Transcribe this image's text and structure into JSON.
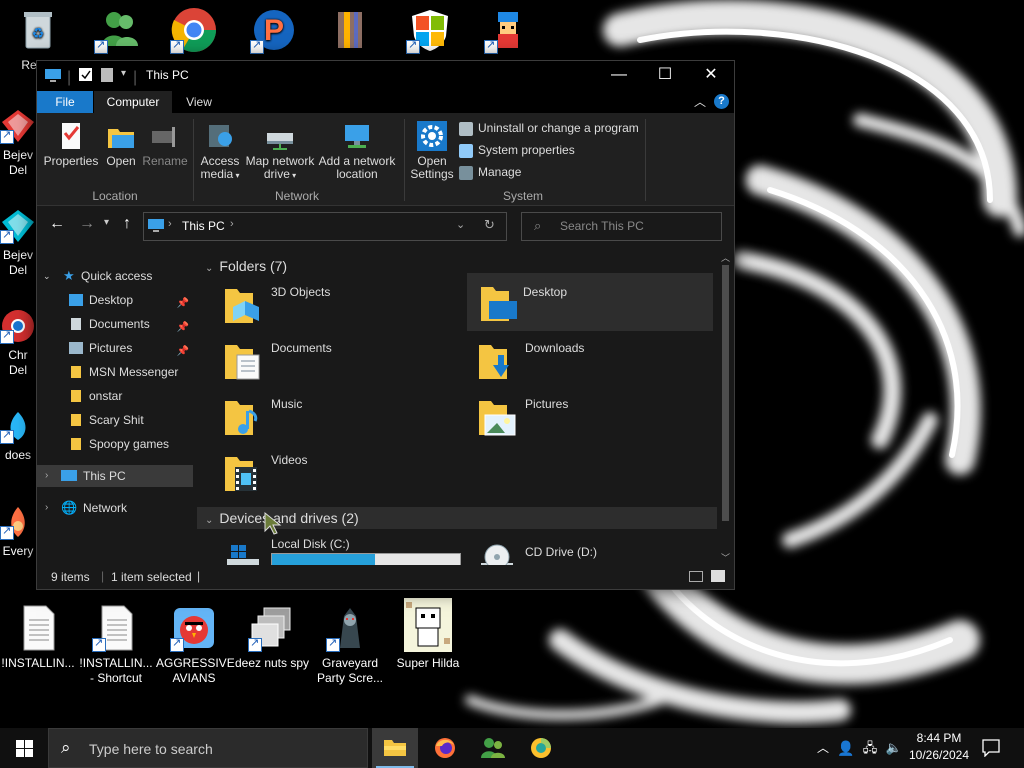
{
  "desktop": {
    "left_icons": [
      "Recyc",
      "Bejev Del",
      "Bejev Del",
      "Chr Del",
      "does",
      "Every"
    ],
    "top_icons": [
      "",
      "",
      "",
      "",
      "",
      "",
      ""
    ],
    "bottom_icons": [
      {
        "label": "!INSTALLIN..."
      },
      {
        "label": "!INSTALLIN... - Shortcut"
      },
      {
        "label": "AGGRESSIVE AVIANS"
      },
      {
        "label": "deez nuts spy"
      },
      {
        "label": "Graveyard Party Scre..."
      },
      {
        "label": "Super Hilda"
      }
    ]
  },
  "window": {
    "title": "This PC",
    "controls": {
      "minimize": "—",
      "maximize": "☐",
      "close": "✕"
    },
    "tabs": [
      {
        "label": "File"
      },
      {
        "label": "Computer"
      },
      {
        "label": "View"
      }
    ],
    "ribbon": {
      "location": {
        "group": "Location",
        "items": [
          "Properties",
          "Open",
          "Rename"
        ]
      },
      "network": {
        "group": "Network",
        "items": [
          "Access media",
          "Map network drive",
          "Add a network location"
        ]
      },
      "system": {
        "group": "System",
        "big": "Open Settings",
        "small": [
          "Uninstall or change a program",
          "System properties",
          "Manage"
        ]
      }
    },
    "address": {
      "path": "This PC",
      "search_placeholder": "Search This PC"
    },
    "nav": {
      "quick_access": "Quick access",
      "quick_items": [
        {
          "label": "Desktop",
          "pinned": true
        },
        {
          "label": "Documents",
          "pinned": true
        },
        {
          "label": "Pictures",
          "pinned": true
        },
        {
          "label": "MSN Messenger",
          "pinned": false
        },
        {
          "label": "onstar",
          "pinned": false
        },
        {
          "label": "Scary Shit",
          "pinned": false
        },
        {
          "label": "Spoopy games",
          "pinned": false
        }
      ],
      "this_pc": "This PC",
      "network": "Network"
    },
    "content": {
      "folders_header": "Folders (7)",
      "folders": [
        "3D Objects",
        "Desktop",
        "Documents",
        "Downloads",
        "Music",
        "Pictures",
        "Videos"
      ],
      "devices_header": "Devices and drives (2)",
      "drives": [
        {
          "label": "Local Disk (C:)",
          "used_fraction": 0.55
        },
        {
          "label": "CD Drive (D:)"
        }
      ]
    },
    "status": {
      "count": "9 items",
      "selected": "1 item selected"
    }
  },
  "taskbar": {
    "search_placeholder": "Type here to search",
    "time": "8:44 PM",
    "date": "10/26/2024"
  },
  "colors": {
    "accent": "#0078d7",
    "folder": "#f4c542",
    "selection": "#2d2d2d"
  }
}
